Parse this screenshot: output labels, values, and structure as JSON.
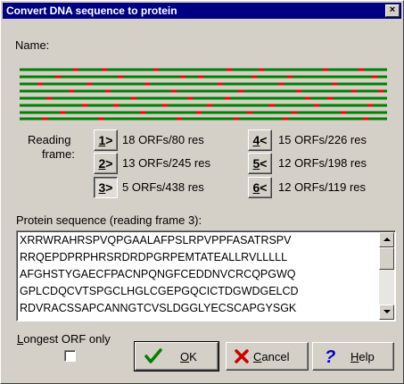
{
  "window": {
    "title": "Convert DNA sequence to protein",
    "close_label": "×"
  },
  "name_label": "Name:",
  "dna_strands": {
    "strand_color": "#008000",
    "marker_color": "#ff0000"
  },
  "reading_frame": {
    "label_line1": "Reading",
    "label_line2": "frame:",
    "frames": [
      {
        "key": "1",
        "arrow": ">",
        "summary": "18 ORFs/80 res"
      },
      {
        "key": "2",
        "arrow": ">",
        "summary": "13 ORFs/245 res"
      },
      {
        "key": "3",
        "arrow": ">",
        "summary": "5 ORFs/438 res"
      },
      {
        "key": "4",
        "arrow": "<",
        "summary": "15 ORFs/226 res"
      },
      {
        "key": "5",
        "arrow": "<",
        "summary": "12 ORFs/198 res"
      },
      {
        "key": "6",
        "arrow": "<",
        "summary": "12 ORFs/119 res"
      }
    ],
    "selected": "3"
  },
  "protein": {
    "label": "Protein sequence (reading frame 3):",
    "lines": [
      "XRRWRAHRSPVQPGAALAFPSLRPVPPFASATRSPV",
      "RRQEPDPRPHRSRDRDPGRPEMTATEALLRVLLLLL",
      "AFGHSTYGAECFPACNPQNGFCEDDNVCRCQPGWQ",
      "GPLCDQCVTSPGCLHGLCGEPGQCICTDGWDGELCD",
      "RDVRACSSAPCANNGTCVSLDGGLYECSCAPGYSGK"
    ]
  },
  "longest_orf": {
    "label_first": "L",
    "label_rest": "ongest ORF only",
    "checked": false
  },
  "buttons": {
    "ok": {
      "u": "O",
      "rest": "K"
    },
    "cancel": {
      "u": "C",
      "rest": "ancel"
    },
    "help": {
      "u": "H",
      "rest": "elp"
    }
  }
}
